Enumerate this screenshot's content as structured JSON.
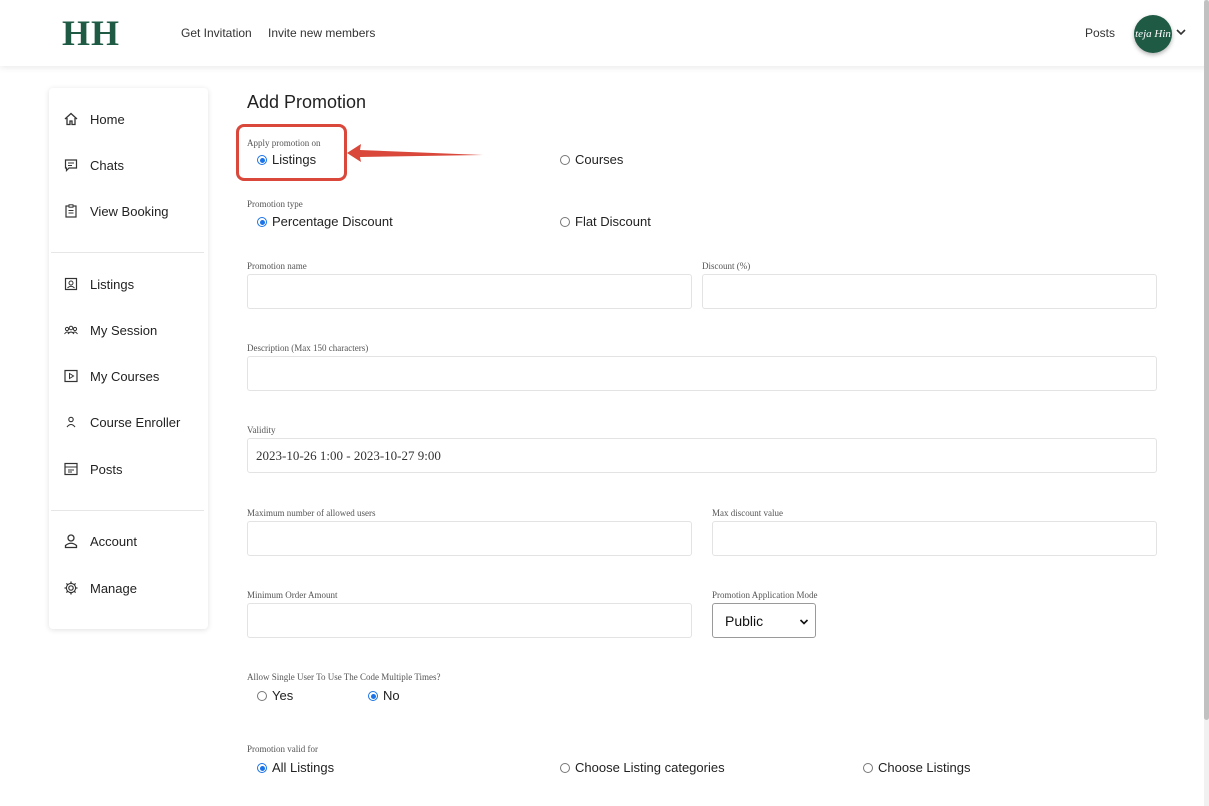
{
  "header": {
    "logo": "HH",
    "nav": [
      "Get Invitation",
      "Invite new members"
    ],
    "posts_link": "Posts",
    "avatar_text": "teja Hin"
  },
  "top_progress_fraction": 0.2,
  "sidebar": {
    "items": [
      {
        "label": "Home",
        "icon": "home-icon"
      },
      {
        "label": "Chats",
        "icon": "chat-icon"
      },
      {
        "label": "View Booking",
        "icon": "clipboard-icon"
      },
      {
        "label": "Listings",
        "icon": "id-card-icon"
      },
      {
        "label": "My Session",
        "icon": "group-icon"
      },
      {
        "label": "My Courses",
        "icon": "play-square-icon"
      },
      {
        "label": "Course Enroller",
        "icon": "user-icon"
      },
      {
        "label": "Posts",
        "icon": "browser-icon"
      },
      {
        "label": "Account",
        "icon": "account-icon"
      },
      {
        "label": "Manage",
        "icon": "gear-icon"
      }
    ]
  },
  "form": {
    "title": "Add Promotion",
    "apply_on": {
      "label": "Apply promotion on",
      "options": [
        "Listings",
        "Courses"
      ],
      "selected": "Listings"
    },
    "promotion_type": {
      "label": "Promotion type",
      "options": [
        "Percentage Discount",
        "Flat Discount"
      ],
      "selected": "Percentage Discount"
    },
    "promotion_name": {
      "label": "Promotion name",
      "value": ""
    },
    "discount": {
      "label": "Discount (%)",
      "value": ""
    },
    "description": {
      "label": "Description (Max 150 characters)",
      "value": ""
    },
    "validity": {
      "label": "Validity",
      "value": "2023-10-26 1:00 - 2023-10-27 9:00"
    },
    "max_users": {
      "label": "Maximum number of allowed users",
      "value": ""
    },
    "max_discount": {
      "label": "Max discount value",
      "value": ""
    },
    "min_order": {
      "label": "Minimum Order Amount",
      "value": ""
    },
    "application_mode": {
      "label": "Promotion Application Mode",
      "value": "Public"
    },
    "multi_use": {
      "label": "Allow Single User To Use The Code Multiple Times?",
      "options": [
        "Yes",
        "No"
      ],
      "selected": "No"
    },
    "valid_for": {
      "label": "Promotion valid for",
      "options": [
        "All Listings",
        "Choose Listing categories",
        "Choose Listings"
      ],
      "selected": "All Listings"
    }
  },
  "colors": {
    "brand": "#1f5a45",
    "accent": "#1a73e8",
    "annotation": "#d9483b"
  }
}
